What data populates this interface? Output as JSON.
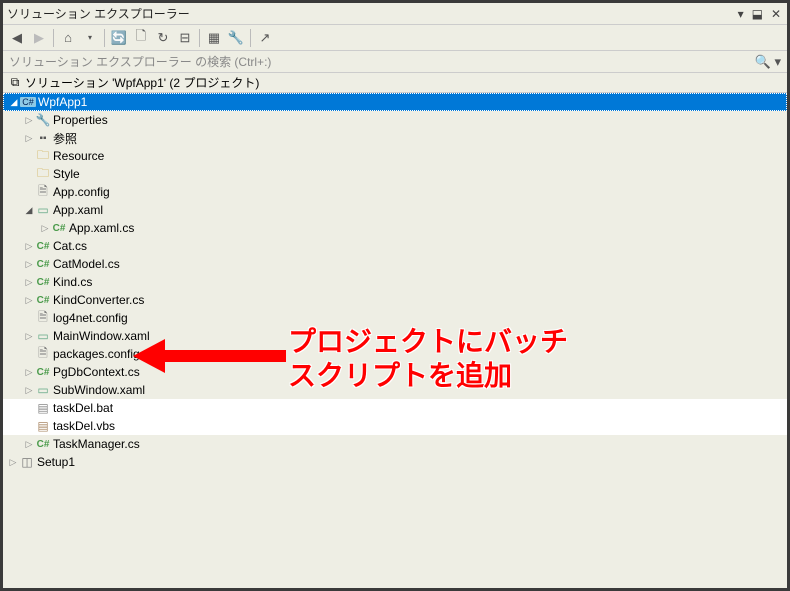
{
  "window": {
    "title": "ソリューション エクスプローラー",
    "pin_tooltip": "ピン",
    "close_tooltip": "閉じる"
  },
  "toolbar": {
    "back": "←",
    "forward": "→",
    "home": "⌂",
    "sync": "⟲",
    "refresh": "↻",
    "collapse": "▭",
    "show_all": "⊞",
    "properties": "✎",
    "view": "↗"
  },
  "search": {
    "placeholder": "ソリューション エクスプローラー の検索 (Ctrl+:)"
  },
  "solution": {
    "icon": "◫",
    "label": "ソリューション 'WpfApp1' (2 プロジェクト)"
  },
  "tree": [
    {
      "depth": 0,
      "exp": "open",
      "icon": "proj",
      "label": "WpfApp1",
      "selected": true
    },
    {
      "depth": 1,
      "exp": "closed",
      "icon": "wrench",
      "label": "Properties"
    },
    {
      "depth": 1,
      "exp": "closed",
      "icon": "ref",
      "label": "参照"
    },
    {
      "depth": 1,
      "exp": "none",
      "icon": "folder",
      "label": "Resource"
    },
    {
      "depth": 1,
      "exp": "none",
      "icon": "folder",
      "label": "Style"
    },
    {
      "depth": 1,
      "exp": "none",
      "icon": "config",
      "label": "App.config"
    },
    {
      "depth": 1,
      "exp": "open",
      "icon": "xaml",
      "label": "App.xaml"
    },
    {
      "depth": 2,
      "exp": "closed",
      "icon": "cs",
      "label": "App.xaml.cs"
    },
    {
      "depth": 1,
      "exp": "closed",
      "icon": "cs",
      "label": "Cat.cs"
    },
    {
      "depth": 1,
      "exp": "closed",
      "icon": "cs",
      "label": "CatModel.cs"
    },
    {
      "depth": 1,
      "exp": "closed",
      "icon": "cs",
      "label": "Kind.cs"
    },
    {
      "depth": 1,
      "exp": "closed",
      "icon": "cs",
      "label": "KindConverter.cs"
    },
    {
      "depth": 1,
      "exp": "none",
      "icon": "config",
      "label": "log4net.config"
    },
    {
      "depth": 1,
      "exp": "closed",
      "icon": "xaml",
      "label": "MainWindow.xaml"
    },
    {
      "depth": 1,
      "exp": "none",
      "icon": "config",
      "label": "packages.config"
    },
    {
      "depth": 1,
      "exp": "closed",
      "icon": "cs",
      "label": "PgDbContext.cs"
    },
    {
      "depth": 1,
      "exp": "closed",
      "icon": "xaml",
      "label": "SubWindow.xaml"
    },
    {
      "depth": 1,
      "exp": "none",
      "icon": "bat",
      "label": "taskDel.bat",
      "highlight": true
    },
    {
      "depth": 1,
      "exp": "none",
      "icon": "vbs",
      "label": "taskDel.vbs",
      "highlight": true
    },
    {
      "depth": 1,
      "exp": "closed",
      "icon": "cs",
      "label": "TaskManager.cs"
    },
    {
      "depth": 0,
      "exp": "closed",
      "icon": "setup",
      "label": "Setup1"
    }
  ],
  "annotation": {
    "line1": "プロジェクトにバッチ",
    "line2": "スクリプトを追加"
  },
  "icons": {
    "folder": "🗀",
    "wrench": "🔧",
    "ref": "▪◾",
    "cs": "C#",
    "config": "⚙",
    "xaml": "▭",
    "bat": "▤",
    "vbs": "▤",
    "proj": "C#",
    "setup": "◫"
  }
}
